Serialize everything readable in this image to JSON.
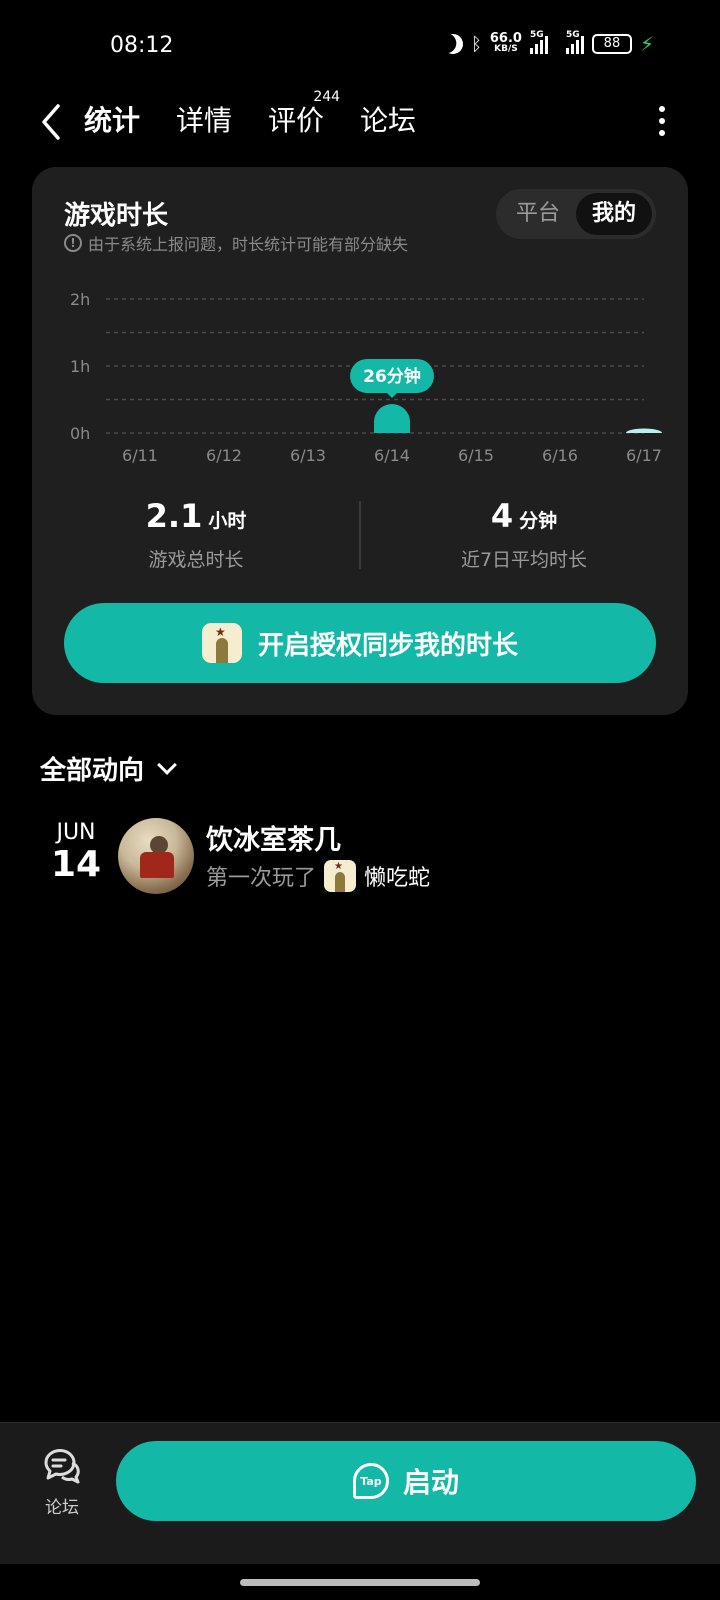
{
  "status": {
    "time": "08:12",
    "net_speed_value": "66.0",
    "net_speed_unit": "KB/S",
    "sig1_label": "5G",
    "sig2_label": "5G",
    "battery": "88"
  },
  "nav": {
    "tabs": [
      {
        "label": "统计"
      },
      {
        "label": "详情"
      },
      {
        "label": "评价",
        "badge": "244"
      },
      {
        "label": "论坛"
      }
    ]
  },
  "card": {
    "title": "游戏时长",
    "note": "由于系统上报问题，时长统计可能有部分缺失",
    "segment": {
      "platform": "平台",
      "mine": "我的"
    },
    "total_value": "2.1",
    "total_unit": "小时",
    "total_label": "游戏总时长",
    "avg_value": "4",
    "avg_unit": "分钟",
    "avg_label": "近7日平均时长",
    "sync_button": "开启授权同步我的时长"
  },
  "chart_data": {
    "type": "bar",
    "categories": [
      "6/11",
      "6/12",
      "6/13",
      "6/14",
      "6/15",
      "6/16",
      "6/17"
    ],
    "values": [
      0,
      0,
      0,
      26,
      0,
      0,
      4
    ],
    "unit": "minutes",
    "y_ticks": [
      "0h",
      "1h",
      "2h"
    ],
    "ylim": [
      0,
      120
    ],
    "highlight_label": "26分钟",
    "grid": true,
    "colors": {
      "bar": "#14b8a6",
      "bar_today": "#b8f2ee",
      "label_bg": "#14b8a6"
    }
  },
  "activity": {
    "section_title": "全部动向",
    "items": [
      {
        "month": "JUN",
        "day": "14",
        "user": "饮冰室茶几",
        "action": "第一次玩了",
        "game": "懒吃蛇"
      }
    ]
  },
  "bottom": {
    "forum_label": "论坛",
    "start_label": "启动",
    "tap_text": "Tap"
  },
  "colors": {
    "accent": "#14b8a6",
    "card_bg": "#1f1f1f"
  }
}
